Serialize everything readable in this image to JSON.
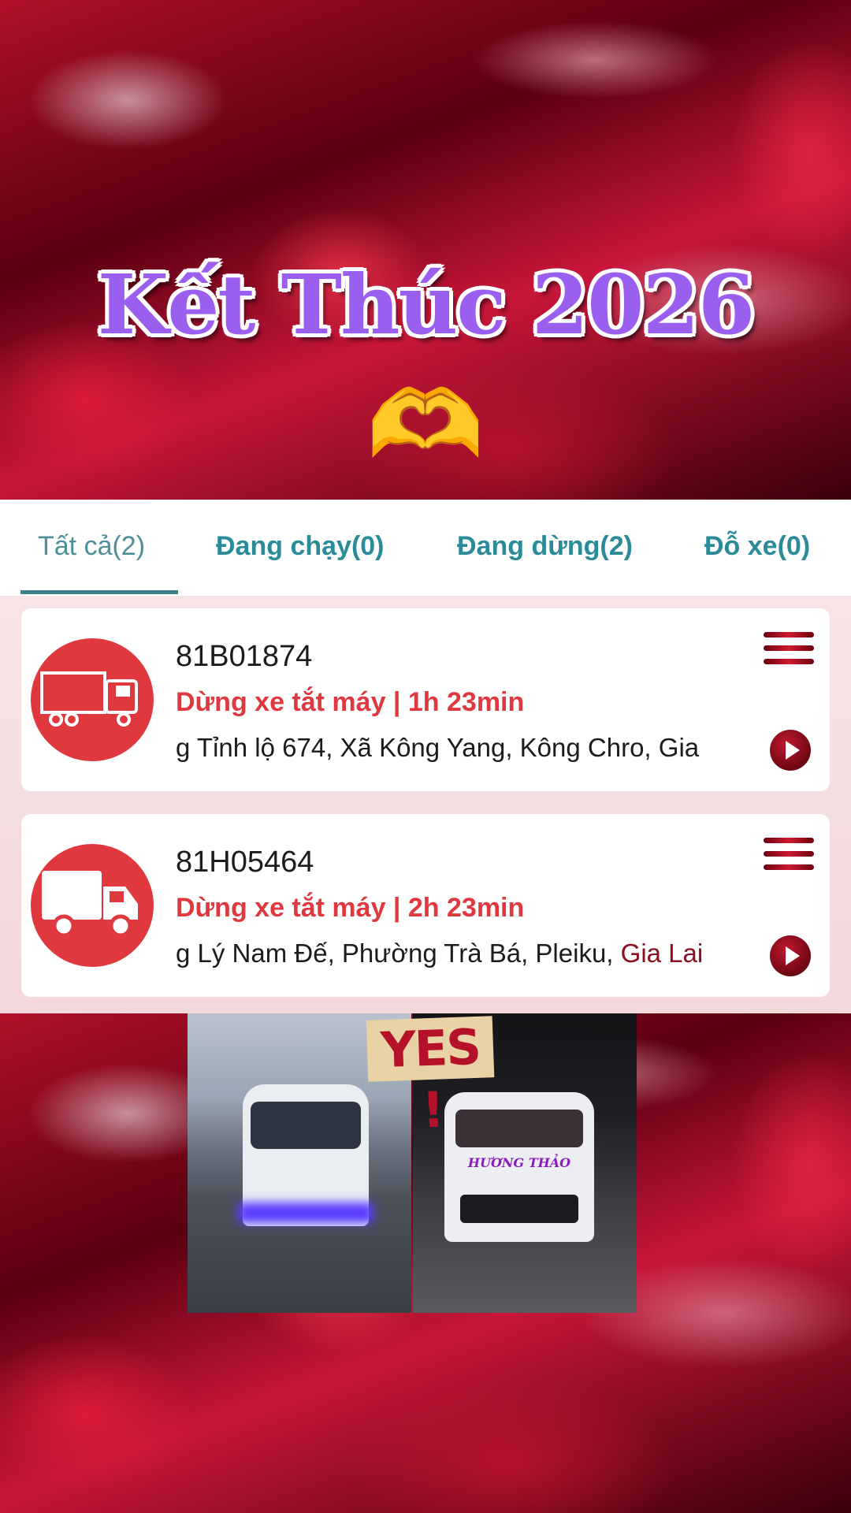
{
  "overlay": {
    "title": "Kết Thúc 2026",
    "emoji": "🫶"
  },
  "tabs": [
    {
      "label": "Tất cả(2)",
      "active": true
    },
    {
      "label": "Đang chạy(0)",
      "active": false
    },
    {
      "label": "Đang dừng(2)",
      "active": false
    },
    {
      "label": "Đỗ xe(0)",
      "active": false
    }
  ],
  "vehicles": [
    {
      "plate": "81B01874",
      "status": "Dừng xe tắt máy | 1h 23min",
      "address": "g Tỉnh lộ 674, Xã Kông Yang, Kông Chro, Gia",
      "icon": "truck-icon"
    },
    {
      "plate": "81H05464",
      "status": "Dừng xe tắt máy | 2h 23min",
      "address_main": "g Lý Nam Đế, Phường Trà Bá, Pleiku, ",
      "address_tail": "Gia Lai",
      "icon": "truck-icon"
    }
  ],
  "collage": {
    "yes_text": "YES !",
    "bus_brand": "HƯƠNG THẢO"
  },
  "colors": {
    "accent_red": "#e0383f",
    "tab_teal": "#2c8b98",
    "title_purple": "#9b5ff0"
  }
}
